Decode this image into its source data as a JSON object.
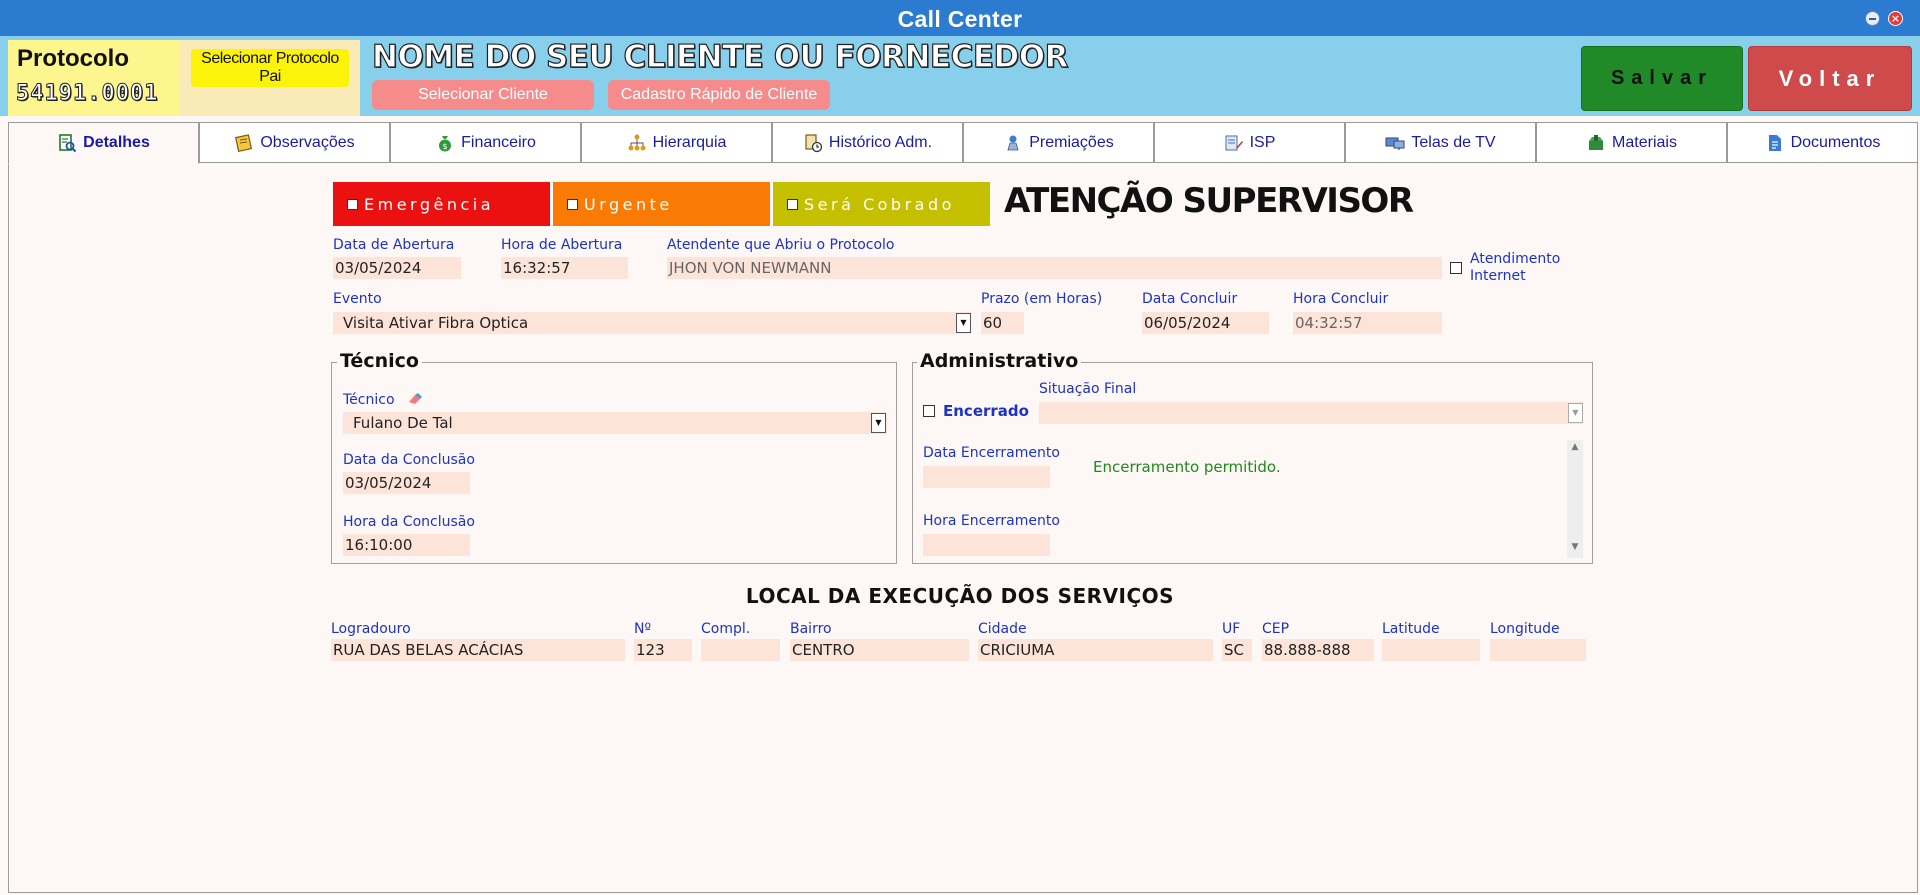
{
  "window": {
    "title": "Call Center"
  },
  "header": {
    "protocolo_label": "Protocolo",
    "protocolo_number": "54191.0001",
    "selecionar_pai": "Selecionar Protocolo Pai",
    "client_name": "NOME DO SEU CLIENTE OU FORNECEDOR",
    "selecionar_cliente": "Selecionar Cliente",
    "cadastro_rapido": "Cadastro Rápido de Cliente",
    "salvar": "Salvar",
    "voltar": "Voltar"
  },
  "tabs": [
    {
      "label": "Detalhes",
      "icon": "magnifier-document-icon",
      "active": true
    },
    {
      "label": "Observações",
      "icon": "notes-icon"
    },
    {
      "label": "Financeiro",
      "icon": "money-bag-icon"
    },
    {
      "label": "Hierarquia",
      "icon": "hierarchy-icon"
    },
    {
      "label": "Histórico Adm.",
      "icon": "history-clock-icon"
    },
    {
      "label": "Premiações",
      "icon": "trophy-icon"
    },
    {
      "label": "ISP",
      "icon": "edit-list-icon"
    },
    {
      "label": "Telas de TV",
      "icon": "monitors-icon"
    },
    {
      "label": "Materiais",
      "icon": "box-icon"
    },
    {
      "label": "Documentos",
      "icon": "document-icon"
    }
  ],
  "flags": {
    "emergencia": "Emergência",
    "urgente": "Urgente",
    "sera_cobrado": "Será Cobrado",
    "atencao": "ATENÇÃO SUPERVISOR"
  },
  "fields": {
    "data_abertura_label": "Data de Abertura",
    "data_abertura": "03/05/2024",
    "hora_abertura_label": "Hora de Abertura",
    "hora_abertura": "16:32:57",
    "atendente_label": "Atendente que Abriu o Protocolo",
    "atendente": "JHON VON NEWMANN",
    "atendimento_internet_label": "Atendimento Internet",
    "evento_label": "Evento",
    "evento": "Visita Ativar Fibra Optica",
    "prazo_label": "Prazo (em Horas)",
    "prazo": "60",
    "data_concluir_label": "Data Concluir",
    "data_concluir": "06/05/2024",
    "hora_concluir_label": "Hora Concluir",
    "hora_concluir": "04:32:57"
  },
  "tecnico": {
    "group_title": "Técnico",
    "tecnico_label": "Técnico",
    "tecnico": "Fulano De Tal",
    "data_conclusao_label": "Data da Conclusão",
    "data_conclusao": "03/05/2024",
    "hora_conclusao_label": "Hora da Conclusão",
    "hora_conclusao": "16:10:00"
  },
  "administrativo": {
    "group_title": "Administrativo",
    "encerrado_label": "Encerrado",
    "situacao_final_label": "Situação Final",
    "situacao_final": "",
    "data_encerramento_label": "Data Encerramento",
    "data_encerramento": "",
    "hora_encerramento_label": "Hora Encerramento",
    "hora_encerramento": "",
    "status_message": "Encerramento permitido."
  },
  "local": {
    "section_title": "LOCAL DA EXECUÇÃO DOS SERVIÇOS",
    "logradouro_label": "Logradouro",
    "logradouro": "RUA DAS BELAS ACÁCIAS",
    "numero_label": "Nº",
    "numero": "123",
    "compl_label": "Compl.",
    "compl": "",
    "bairro_label": "Bairro",
    "bairro": "CENTRO",
    "cidade_label": "Cidade",
    "cidade": "CRICIUMA",
    "uf_label": "UF",
    "uf": "SC",
    "cep_label": "CEP",
    "cep": "88.888-888",
    "latitude_label": "Latitude",
    "latitude": "",
    "longitude_label": "Longitude",
    "longitude": ""
  },
  "colors": {
    "titlebar": "#2b7bd1",
    "header_band": "#88cfec",
    "emergencia": "#ec1111",
    "urgente": "#fa7a06",
    "sera_cobrado": "#c4c000",
    "salvar": "#1f8a27",
    "voltar": "#cf4a4a",
    "label_blue": "#1b33c7",
    "field_bg": "#fde4d8"
  }
}
